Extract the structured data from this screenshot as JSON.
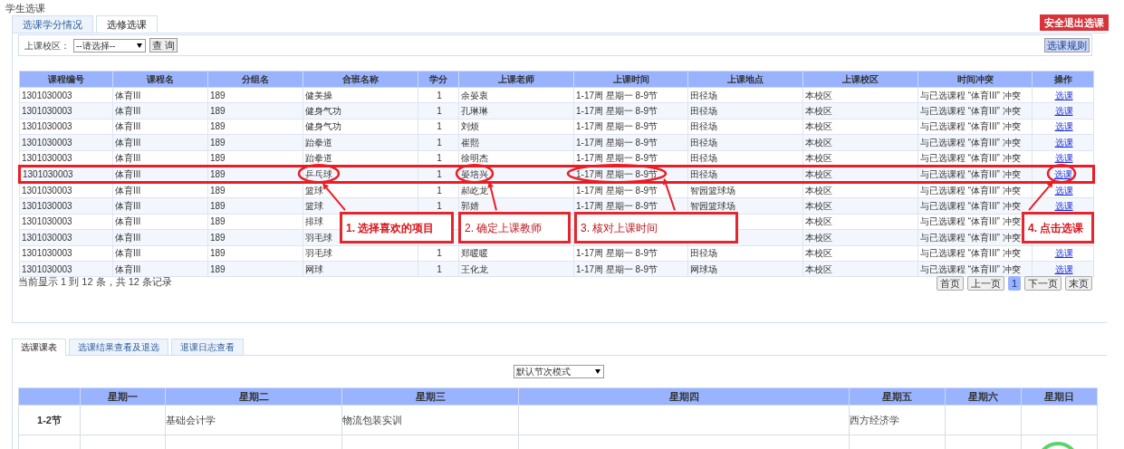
{
  "page_title": "学生选课",
  "top_tabs": [
    {
      "label": "选课学分情况",
      "selected": false
    },
    {
      "label": "选修选课",
      "selected": true
    }
  ],
  "exit_button": "安全退出选课",
  "filter": {
    "label": "上课校区：",
    "select_value": "--请选择--",
    "search_button": "查 询",
    "rules_button": "选课规则"
  },
  "course_table": {
    "columns": [
      "课程编号",
      "课程名",
      "分组名",
      "合班名称",
      "学分",
      "上课老师",
      "上课时间",
      "上课地点",
      "上课校区",
      "时间冲突",
      "操作"
    ],
    "rows": [
      {
        "highlighted": false,
        "cells": [
          "1301030003",
          "体育III",
          "189",
          "健美操",
          "1",
          "余晏衷",
          "1-17周 星期一 8-9节",
          "田径场",
          "本校区",
          "与已选课程 “体育III” 冲突",
          "选课"
        ]
      },
      {
        "highlighted": false,
        "cells": [
          "1301030003",
          "体育III",
          "189",
          "健身气功",
          "1",
          "孔琳琳",
          "1-17周 星期一 8-9节",
          "田径场",
          "本校区",
          "与已选课程 “体育III” 冲突",
          "选课"
        ]
      },
      {
        "highlighted": false,
        "cells": [
          "1301030003",
          "体育III",
          "189",
          "健身气功",
          "1",
          "刘烦",
          "1-17周 星期一 8-9节",
          "田径场",
          "本校区",
          "与已选课程 “体育III” 冲突",
          "选课"
        ]
      },
      {
        "highlighted": false,
        "cells": [
          "1301030003",
          "体育III",
          "189",
          "跆拳道",
          "1",
          "崔熙",
          "1-17周 星期一 8-9节",
          "田径场",
          "本校区",
          "与已选课程 “体育III” 冲突",
          "选课"
        ]
      },
      {
        "highlighted": false,
        "cells": [
          "1301030003",
          "体育III",
          "189",
          "跆拳道",
          "1",
          "徐明杰",
          "1-17周 星期一 8-9节",
          "田径场",
          "本校区",
          "与已选课程 “体育III” 冲突",
          "选课"
        ]
      },
      {
        "highlighted": true,
        "cells": [
          "1301030003",
          "体育III",
          "189",
          "乒乓球",
          "1",
          "晏培兴",
          "1-17周 星期一 8-9节",
          "田径场",
          "本校区",
          "与已选课程 “体育III” 冲突",
          "选课"
        ]
      },
      {
        "highlighted": false,
        "cells": [
          "1301030003",
          "体育III",
          "189",
          "篮球",
          "1",
          "郝屹龙",
          "1-17周 星期一 8-9节",
          "智园篮球场",
          "本校区",
          "与已选课程 “体育III” 冲突",
          "选课"
        ]
      },
      {
        "highlighted": false,
        "cells": [
          "1301030003",
          "体育III",
          "189",
          "篮球",
          "1",
          "郭婧",
          "1-17周 星期一 8-9节",
          "智园篮球场",
          "本校区",
          "与已选课程 “体育III” 冲突",
          "选课"
        ]
      },
      {
        "highlighted": false,
        "cells": [
          "1301030003",
          "体育III",
          "189",
          "排球",
          null,
          null,
          null,
          null,
          "本校区",
          "与已选课程 “体育III” 冲突",
          null
        ]
      },
      {
        "highlighted": false,
        "cells": [
          "1301030003",
          "体育III",
          "189",
          "羽毛球",
          null,
          null,
          null,
          null,
          "本校区",
          "与已选课程 “体育III” 冲突",
          null
        ]
      },
      {
        "highlighted": false,
        "cells": [
          "1301030003",
          "体育III",
          "189",
          "羽毛球",
          "1",
          "郑暖暖",
          "1-17周 星期一 8-9节",
          "田径场",
          "本校区",
          "与已选课程 “体育III” 冲突",
          "选课"
        ]
      },
      {
        "highlighted": false,
        "cells": [
          "1301030003",
          "体育III",
          "189",
          "网球",
          "1",
          "王化龙",
          "1-17周 星期一 8-9节",
          "网球场",
          "本校区",
          "与已选课程 “体育III” 冲突",
          "选课"
        ]
      }
    ]
  },
  "record_info": "当前显示 1 到 12 条，共 12 条记录",
  "pager": [
    {
      "label": "首页",
      "selected": false
    },
    {
      "label": "上一页",
      "selected": false
    },
    {
      "label": "1",
      "selected": true
    },
    {
      "label": "下一页",
      "selected": false
    },
    {
      "label": "末页",
      "selected": false
    }
  ],
  "annotations": [
    {
      "text": "1. 选择喜欢的项目",
      "bold": true
    },
    {
      "text": "2. 确定上课教师",
      "bold": false
    },
    {
      "text": "3. 核对上课时间",
      "bold": false
    },
    {
      "text": "4. 点击选课",
      "bold": true
    }
  ],
  "bottom_tabs": [
    {
      "label": "选课课表",
      "selected": true
    },
    {
      "label": "选课结果查看及退选",
      "selected": false
    },
    {
      "label": "退课日志查看",
      "selected": false
    }
  ],
  "schedule_mode": "默认节次模式",
  "schedule": {
    "columns": [
      "星期一",
      "星期二",
      "星期三",
      "星期四",
      "星期五",
      "星期六",
      "星期日"
    ],
    "rows": [
      {
        "period": "1-2节",
        "cells": [
          null,
          "基础会计学",
          "物流包装实训",
          null,
          "西方经济学",
          null,
          null
        ]
      }
    ]
  }
}
